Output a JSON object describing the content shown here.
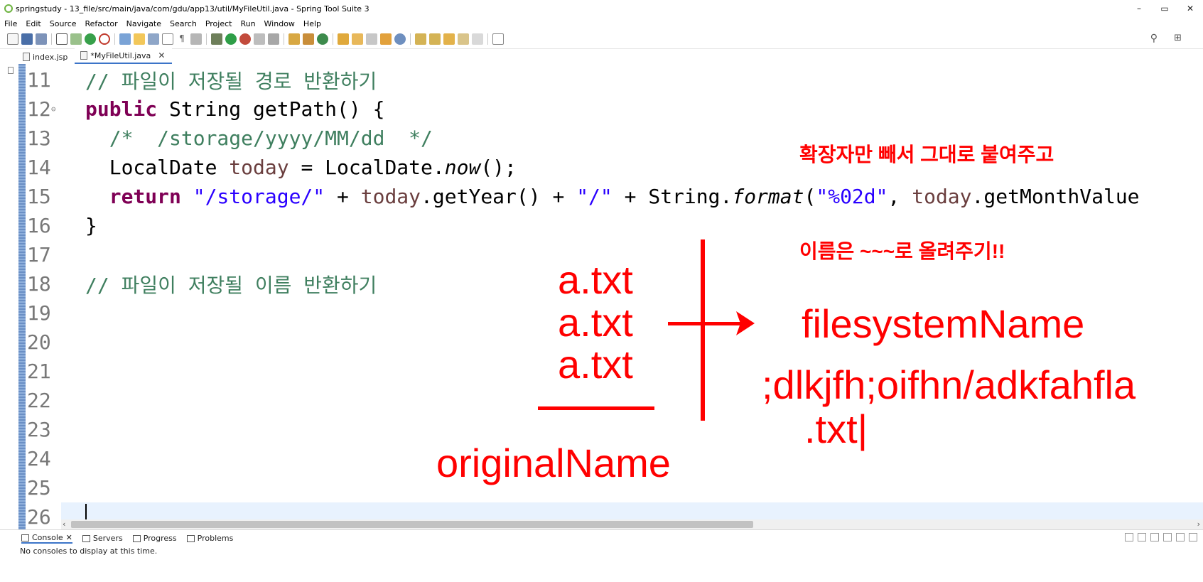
{
  "window": {
    "title": "springstudy - 13_file/src/main/java/com/gdu/app13/util/MyFileUtil.java - Spring Tool Suite 3",
    "controls": [
      "–",
      "▭",
      "✕"
    ]
  },
  "menu": [
    "File",
    "Edit",
    "Source",
    "Refactor",
    "Navigate",
    "Search",
    "Project",
    "Run",
    "Window",
    "Help"
  ],
  "tabs": [
    {
      "label": "index.jsp",
      "active": false
    },
    {
      "label": "*MyFileUtil.java",
      "active": true
    }
  ],
  "code_lines": [
    {
      "num": "11",
      "parts": [
        {
          "t": "// 파일이 저장될 경로 반환하기",
          "c": "cm"
        }
      ]
    },
    {
      "num": "12",
      "fold": "⊖",
      "parts": [
        {
          "t": "public",
          "c": "kw"
        },
        {
          "t": " String getPath() {",
          "c": ""
        }
      ]
    },
    {
      "num": "13",
      "parts": [
        {
          "t": "  /*  /storage/yyyy/MM/dd  */",
          "c": "cm"
        }
      ]
    },
    {
      "num": "14",
      "parts": [
        {
          "t": "  LocalDate ",
          "c": ""
        },
        {
          "t": "today",
          "c": "fld"
        },
        {
          "t": " = LocalDate.",
          "c": ""
        },
        {
          "t": "now",
          "c": "it"
        },
        {
          "t": "();",
          "c": ""
        }
      ]
    },
    {
      "num": "15",
      "parts": [
        {
          "t": "  return",
          "c": "kw"
        },
        {
          "t": " ",
          "c": ""
        },
        {
          "t": "\"/storage/\"",
          "c": "str"
        },
        {
          "t": " + ",
          "c": ""
        },
        {
          "t": "today",
          "c": "fld"
        },
        {
          "t": ".getYear() + ",
          "c": ""
        },
        {
          "t": "\"/\"",
          "c": "str"
        },
        {
          "t": " + String.",
          "c": ""
        },
        {
          "t": "format",
          "c": "it"
        },
        {
          "t": "(",
          "c": ""
        },
        {
          "t": "\"%02d\"",
          "c": "str"
        },
        {
          "t": ", ",
          "c": ""
        },
        {
          "t": "today",
          "c": "fld"
        },
        {
          "t": ".getMonthValue",
          "c": ""
        }
      ]
    },
    {
      "num": "16",
      "parts": [
        {
          "t": "}",
          "c": ""
        }
      ]
    },
    {
      "num": "17",
      "parts": []
    },
    {
      "num": "18",
      "parts": [
        {
          "t": "// 파일이 저장될 이름 반환하기",
          "c": "cm"
        }
      ]
    },
    {
      "num": "19",
      "parts": []
    },
    {
      "num": "20",
      "parts": []
    },
    {
      "num": "21",
      "parts": []
    },
    {
      "num": "22",
      "parts": []
    },
    {
      "num": "23",
      "parts": []
    },
    {
      "num": "24",
      "parts": []
    },
    {
      "num": "25",
      "parts": []
    },
    {
      "num": "26",
      "parts": [],
      "current": true
    }
  ],
  "annotations": {
    "note1": "확장자만 빼서 그대로 붙여주고",
    "note2": "이름은 ~~~로 올려주기!!",
    "file1": "a.txt",
    "file2": "a.txt",
    "file3": "a.txt",
    "original": "originalName",
    "filesystem": "filesystemName",
    "random": ";dlkjfh;oifhn/adkfahfla",
    "ext": ".txt|"
  },
  "bottom_panel": {
    "tabs": [
      "Console",
      "Servers",
      "Progress",
      "Problems"
    ],
    "message": "No consoles to display at this time."
  },
  "colors": {
    "annotation_red": "#ff0000",
    "keyword": "#7f0055",
    "comment": "#3f7f5f",
    "string": "#2a00ff",
    "field": "#6a3e3e"
  }
}
